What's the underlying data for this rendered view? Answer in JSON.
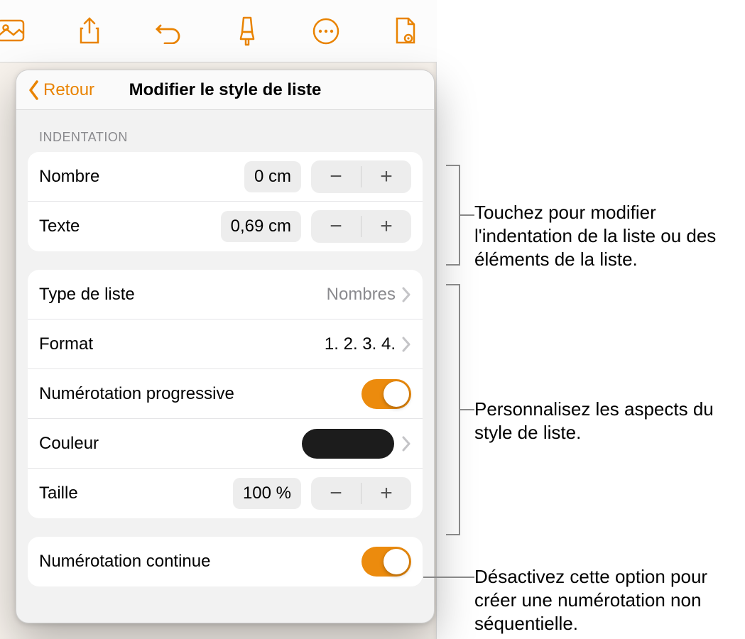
{
  "toolbar": {
    "icons": [
      "image-icon",
      "share-icon",
      "undo-icon",
      "brush-icon",
      "more-icon",
      "document-icon"
    ]
  },
  "popover": {
    "back_label": "Retour",
    "title": "Modifier le style de liste",
    "indentation_header": "INDENTATION",
    "rows": {
      "nombre": {
        "label": "Nombre",
        "value": "0 cm"
      },
      "texte": {
        "label": "Texte",
        "value": "0,69 cm"
      },
      "type": {
        "label": "Type de liste",
        "value": "Nombres"
      },
      "format": {
        "label": "Format",
        "value": "1. 2. 3. 4."
      },
      "progressive": {
        "label": "Numérotation progressive",
        "on": true
      },
      "couleur": {
        "label": "Couleur",
        "color": "#1c1c1c"
      },
      "taille": {
        "label": "Taille",
        "value": "100 %"
      },
      "continue": {
        "label": "Numérotation continue",
        "on": true
      }
    },
    "stepper": {
      "minus": "−",
      "plus": "+"
    }
  },
  "callouts": {
    "indentation": "Touchez pour modifier l'indentation de la liste ou des éléments de la liste.",
    "aspects": "Personnalisez les aspects du style de liste.",
    "continue": "Désactivez cette option pour créer une numérotation non séquentielle."
  }
}
